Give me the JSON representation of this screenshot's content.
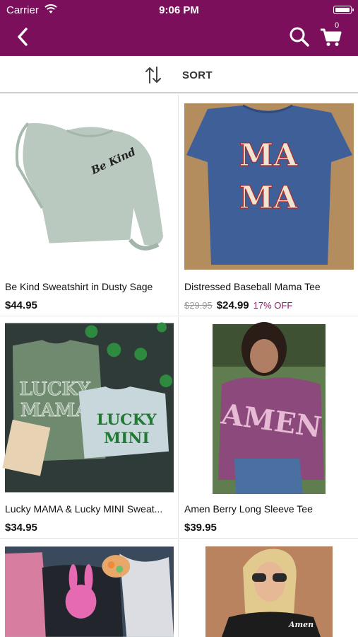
{
  "status_bar": {
    "carrier": "Carrier",
    "time": "9:06 PM"
  },
  "nav": {
    "back_icon": "chevron-left-icon",
    "search_icon": "search-icon",
    "cart_icon": "cart-icon",
    "cart_count": "0"
  },
  "sort": {
    "label": "SORT",
    "icon": "sort-arrows-icon"
  },
  "colors": {
    "brand": "#7b0f5c",
    "discount": "#8e1b6a"
  },
  "products": [
    {
      "title": "Be Kind Sweatshirt in Dusty Sage",
      "price": "$44.95"
    },
    {
      "title": "Distressed Baseball Mama Tee",
      "old_price": "$29.95",
      "price": "$24.99",
      "discount": "17% OFF"
    },
    {
      "title": "Lucky MAMA & Lucky MINI Sweat...",
      "price": "$34.95"
    },
    {
      "title": "Amen Berry Long Sleeve Tee",
      "price": "$39.95"
    }
  ],
  "images": {
    "p1_script": "Be Kind",
    "p2_line1": "MA",
    "p2_line2": "MA",
    "p3_left": "LUCKY",
    "p3_left2": "MAMA",
    "p3_right": "LUCKY",
    "p3_right2": "MINI",
    "p4_text": "AMEN",
    "p6_script": "Amen"
  }
}
